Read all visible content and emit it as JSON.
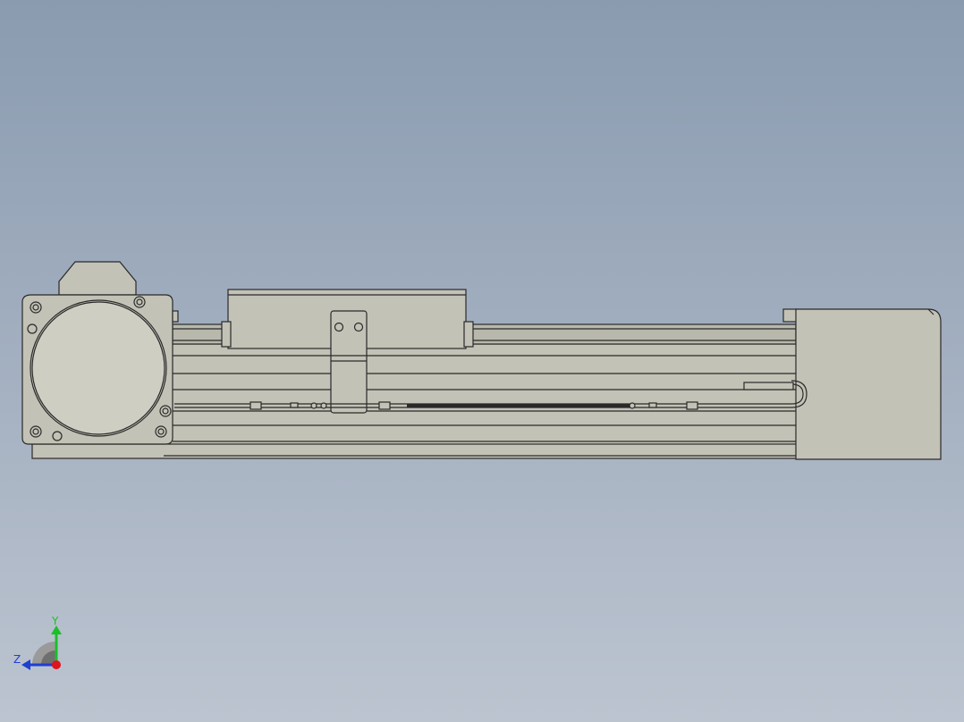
{
  "viewport": {
    "background_top": "#8a9bb0",
    "background_bottom": "#bcc4d0"
  },
  "model": {
    "part_color": "#c3c2b6",
    "part_light": "#cfcec3",
    "edge_color": "#2a2a2a",
    "rail_color": "#b8b8ad"
  },
  "triad": {
    "y_label": "Y",
    "z_label": "Z",
    "y_color": "#19c02a",
    "z_color": "#1f3fd0",
    "x_color": "#e0141c"
  }
}
